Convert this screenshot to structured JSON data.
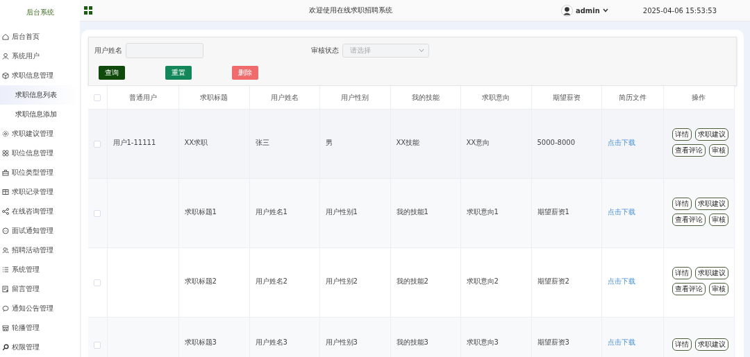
{
  "sidebar": {
    "title": "后台系统",
    "items": [
      {
        "label": "后台首页",
        "selected": false
      },
      {
        "label": "系统用户",
        "selected": false
      },
      {
        "label": "求职信息管理",
        "selected": false,
        "expanded": true,
        "children": [
          {
            "label": "求职信息列表",
            "selected": true
          },
          {
            "label": "求职信息添加",
            "selected": false
          }
        ]
      },
      {
        "label": "求职建议管理",
        "selected": false
      },
      {
        "label": "职位信息管理",
        "selected": false
      },
      {
        "label": "职位类型管理",
        "selected": false
      },
      {
        "label": "求职记录管理",
        "selected": false
      },
      {
        "label": "在线咨询管理",
        "selected": false
      },
      {
        "label": "面试通知管理",
        "selected": false
      },
      {
        "label": "招聘活动管理",
        "selected": false
      },
      {
        "label": "系统管理",
        "selected": false
      },
      {
        "label": "留言管理",
        "selected": false
      },
      {
        "label": "通知公告管理",
        "selected": false
      },
      {
        "label": "轮播管理",
        "selected": false
      },
      {
        "label": "权限管理",
        "selected": false
      }
    ]
  },
  "header": {
    "title": "欢迎使用在线求职招聘系统",
    "user": "admin",
    "datetime": "2025-04-06 15:53:53"
  },
  "filters": [
    {
      "label": "用户姓名",
      "kind": "text"
    },
    {
      "label": "审核状态",
      "kind": "select",
      "placeholder": "请选择"
    }
  ],
  "actions": [
    {
      "label": "查询",
      "kind": "search"
    },
    {
      "label": "重置",
      "kind": "reset"
    },
    {
      "label": "删除",
      "kind": "delete"
    }
  ],
  "table": {
    "all_checked": false,
    "columns": [
      "普通用户",
      "求职标题",
      "用户姓名",
      "用户性别",
      "我的技能",
      "求职意向",
      "期望薪资",
      "简历文件",
      "操作"
    ],
    "rows": [
      {
        "checked": false,
        "cells": [
          "用户1-11111",
          "XX求职",
          "张三",
          "男",
          "XX技能",
          "XX意向",
          "5000-8000"
        ],
        "file": "点击下载",
        "buttons": [
          "详情",
          "求职建议",
          "查看评论",
          "审核"
        ]
      },
      {
        "checked": false,
        "cells": [
          "",
          "求职标题1",
          "用户姓名1",
          "用户性别1",
          "我的技能1",
          "求职意向1",
          "期望薪资1"
        ],
        "file": "点击下载",
        "buttons": [
          "详情",
          "求职建议",
          "查看评论",
          "审核"
        ]
      },
      {
        "checked": false,
        "cells": [
          "",
          "求职标题2",
          "用户姓名2",
          "用户性别2",
          "我的技能2",
          "求职意向2",
          "期望薪资2"
        ],
        "file": "点击下载",
        "buttons": [
          "详情",
          "求职建议",
          "查看评论",
          "审核"
        ]
      },
      {
        "checked": false,
        "cells": [
          "",
          "求职标题3",
          "用户姓名3",
          "用户性别3",
          "我的技能3",
          "求职意向3",
          "期望薪资3"
        ],
        "file": "点击下载",
        "buttons": [
          "详情",
          "求职建议"
        ]
      }
    ]
  }
}
